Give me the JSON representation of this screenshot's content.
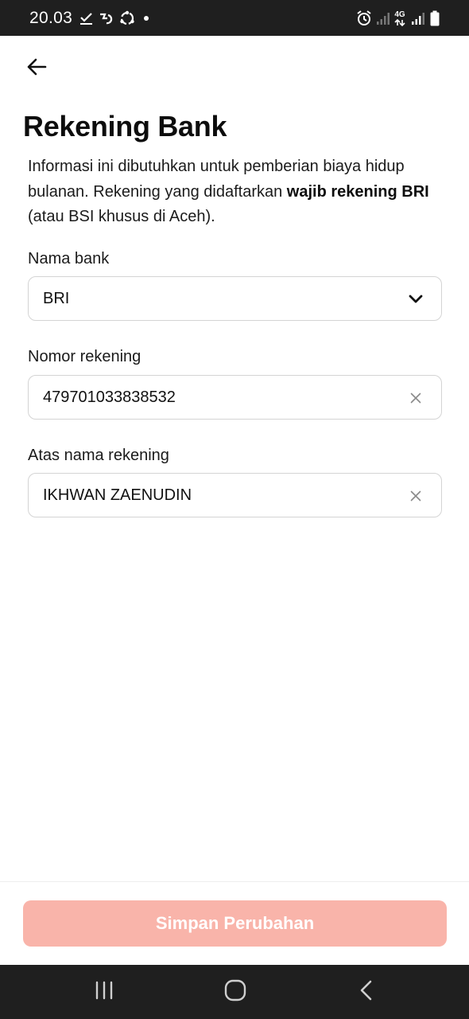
{
  "status_bar": {
    "time": "20.03",
    "network_label": "4G"
  },
  "header": {
    "back_icon": "arrow-left-icon",
    "title": "Rekening Bank"
  },
  "description": {
    "text_before": "Informasi ini dibutuhkan untuk pemberian biaya hidup bulanan. Rekening yang didaftarkan ",
    "text_bold": "wajib rekening BRI",
    "text_after": " (atau BSI  khusus di Aceh)."
  },
  "form": {
    "bank": {
      "label": "Nama bank",
      "value": "BRI",
      "icon": "chevron-down-icon"
    },
    "account_number": {
      "label": "Nomor rekening",
      "value": "479701033838532",
      "icon": "clear-icon"
    },
    "account_name": {
      "label": "Atas nama rekening",
      "value": "IKHWAN ZAENUDIN",
      "icon": "clear-icon"
    }
  },
  "actions": {
    "save_label": "Simpan Perubahan",
    "save_enabled": false,
    "save_color": "#f9b4aa"
  },
  "nav_bar": {
    "recents_icon": "recents-icon",
    "home_icon": "home-icon",
    "back_icon": "back-icon"
  }
}
